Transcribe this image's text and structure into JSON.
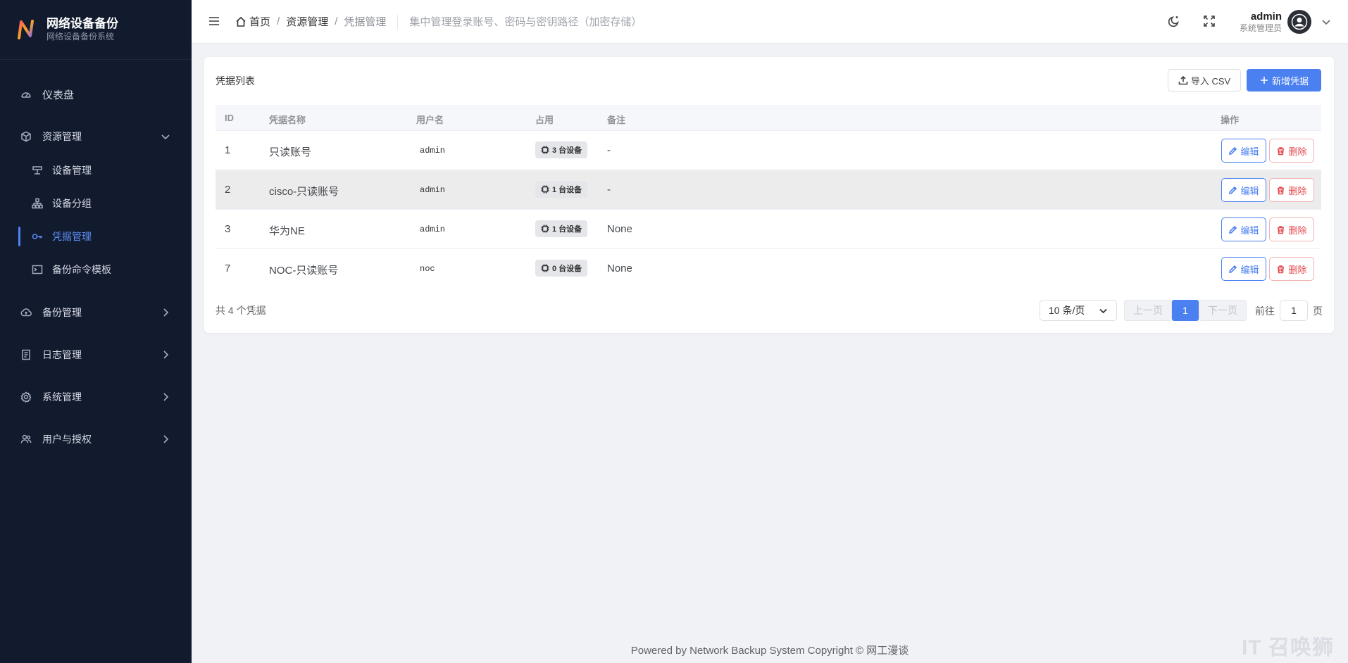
{
  "brand": {
    "title": "网络设备备份",
    "subtitle": "网络设备备份系统"
  },
  "sidebar": {
    "dashboard": "仪表盘",
    "resource": "资源管理",
    "resource_children": [
      "设备管理",
      "设备分组",
      "凭据管理",
      "备份命令模板"
    ],
    "backup": "备份管理",
    "logs": "日志管理",
    "system": "系统管理",
    "users": "用户与授权"
  },
  "header": {
    "breadcrumb": [
      "首页",
      "资源管理",
      "凭据管理"
    ],
    "description": "集中管理登录账号、密码与密钥路径（加密存储）",
    "user_name": "admin",
    "user_role": "系统管理员"
  },
  "card": {
    "title": "凭据列表",
    "import_label": "导入 CSV",
    "add_label": "新增凭据"
  },
  "table": {
    "columns": [
      "ID",
      "凭据名称",
      "用户名",
      "占用",
      "备注",
      "操作"
    ],
    "rows": [
      {
        "id": "1",
        "name": "只读账号",
        "username": "admin",
        "usage": "3 台设备",
        "remark": "-"
      },
      {
        "id": "2",
        "name": "cisco-只读账号",
        "username": "admin",
        "usage": "1 台设备",
        "remark": "-"
      },
      {
        "id": "3",
        "name": "华为NE",
        "username": "admin",
        "usage": "1 台设备",
        "remark": "None"
      },
      {
        "id": "7",
        "name": "NOC-只读账号",
        "username": "noc",
        "usage": "0 台设备",
        "remark": "None"
      }
    ],
    "edit_label": "编辑",
    "delete_label": "删除"
  },
  "pagination": {
    "total": "共 4 个凭据",
    "page_size": "10 条/页",
    "prev": "上一页",
    "current": "1",
    "next": "下一页",
    "goto_prefix": "前往",
    "goto_value": "1",
    "goto_suffix": "页"
  },
  "footer": "Powered by Network Backup System Copyright © 网工漫谈",
  "watermark": "IT 召唤狮",
  "colors": {
    "primary": "#4a80f0",
    "danger": "#e5484d",
    "sidebar": "#121a2e"
  }
}
